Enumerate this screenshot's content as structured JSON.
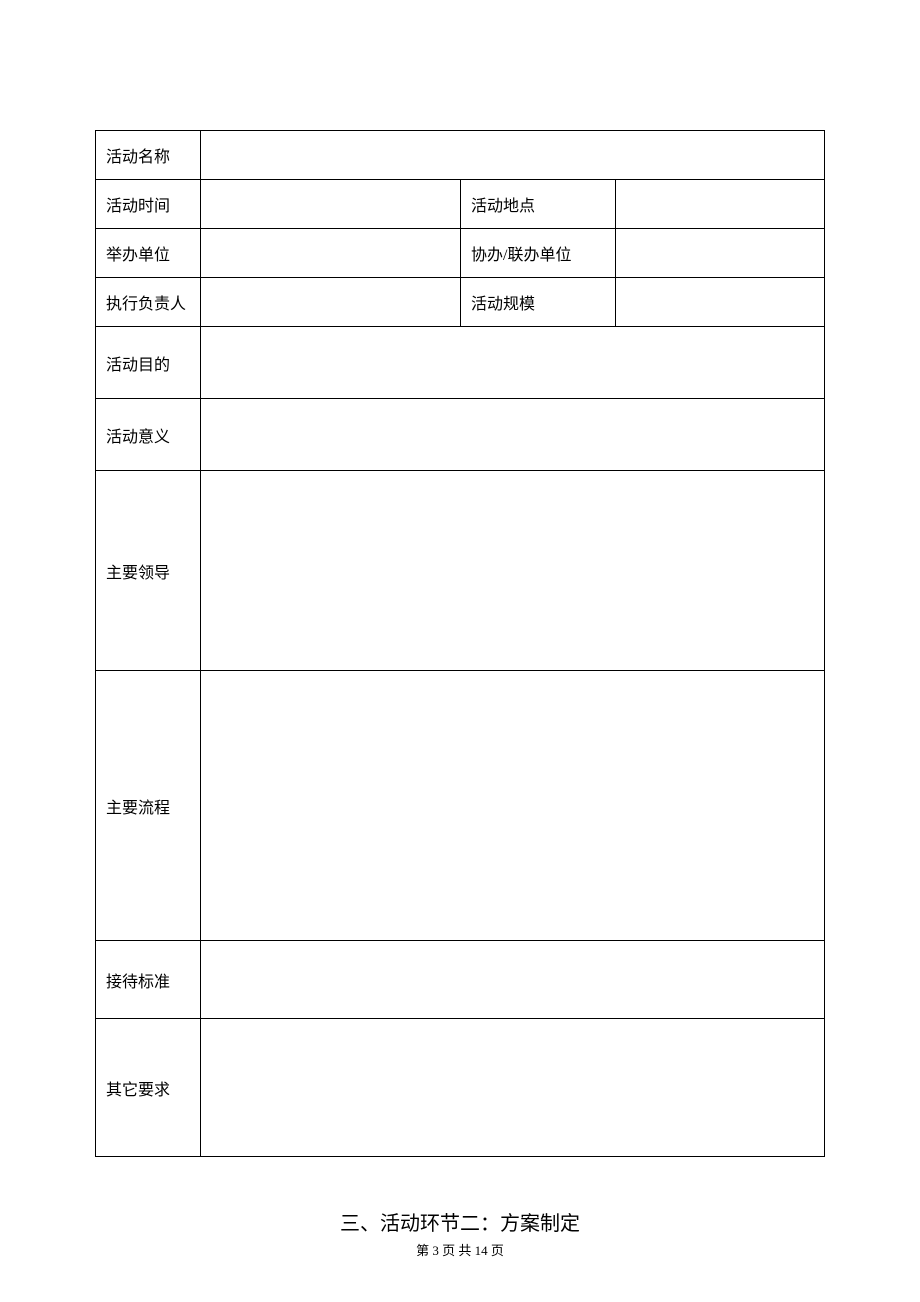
{
  "table": {
    "rows": [
      {
        "label1": "活动名称",
        "value1": "",
        "label2": "",
        "value2": "",
        "fullspan": true
      },
      {
        "label1": "活动时间",
        "value1": "",
        "label2": "活动地点",
        "value2": ""
      },
      {
        "label1": "举办单位",
        "value1": "",
        "label2": "协办/联办单位",
        "value2": ""
      },
      {
        "label1": "执行负责人",
        "value1": "",
        "label2": "活动规模",
        "value2": ""
      }
    ],
    "narrow_rows": [
      {
        "label": "活动目的",
        "value": ""
      },
      {
        "label": "活动意义",
        "value": ""
      }
    ],
    "tall_rows": [
      {
        "label": "主要领导",
        "value": ""
      },
      {
        "label": "主要流程",
        "value": ""
      }
    ],
    "bottom_rows": [
      {
        "label": "接待标准",
        "value": ""
      },
      {
        "label": "其它要求",
        "value": ""
      }
    ]
  },
  "heading": "三、活动环节二：方案制定",
  "footer": {
    "prefix": "第",
    "current_page": "3",
    "middle": "页 共",
    "total_pages": "14",
    "suffix": "页"
  }
}
